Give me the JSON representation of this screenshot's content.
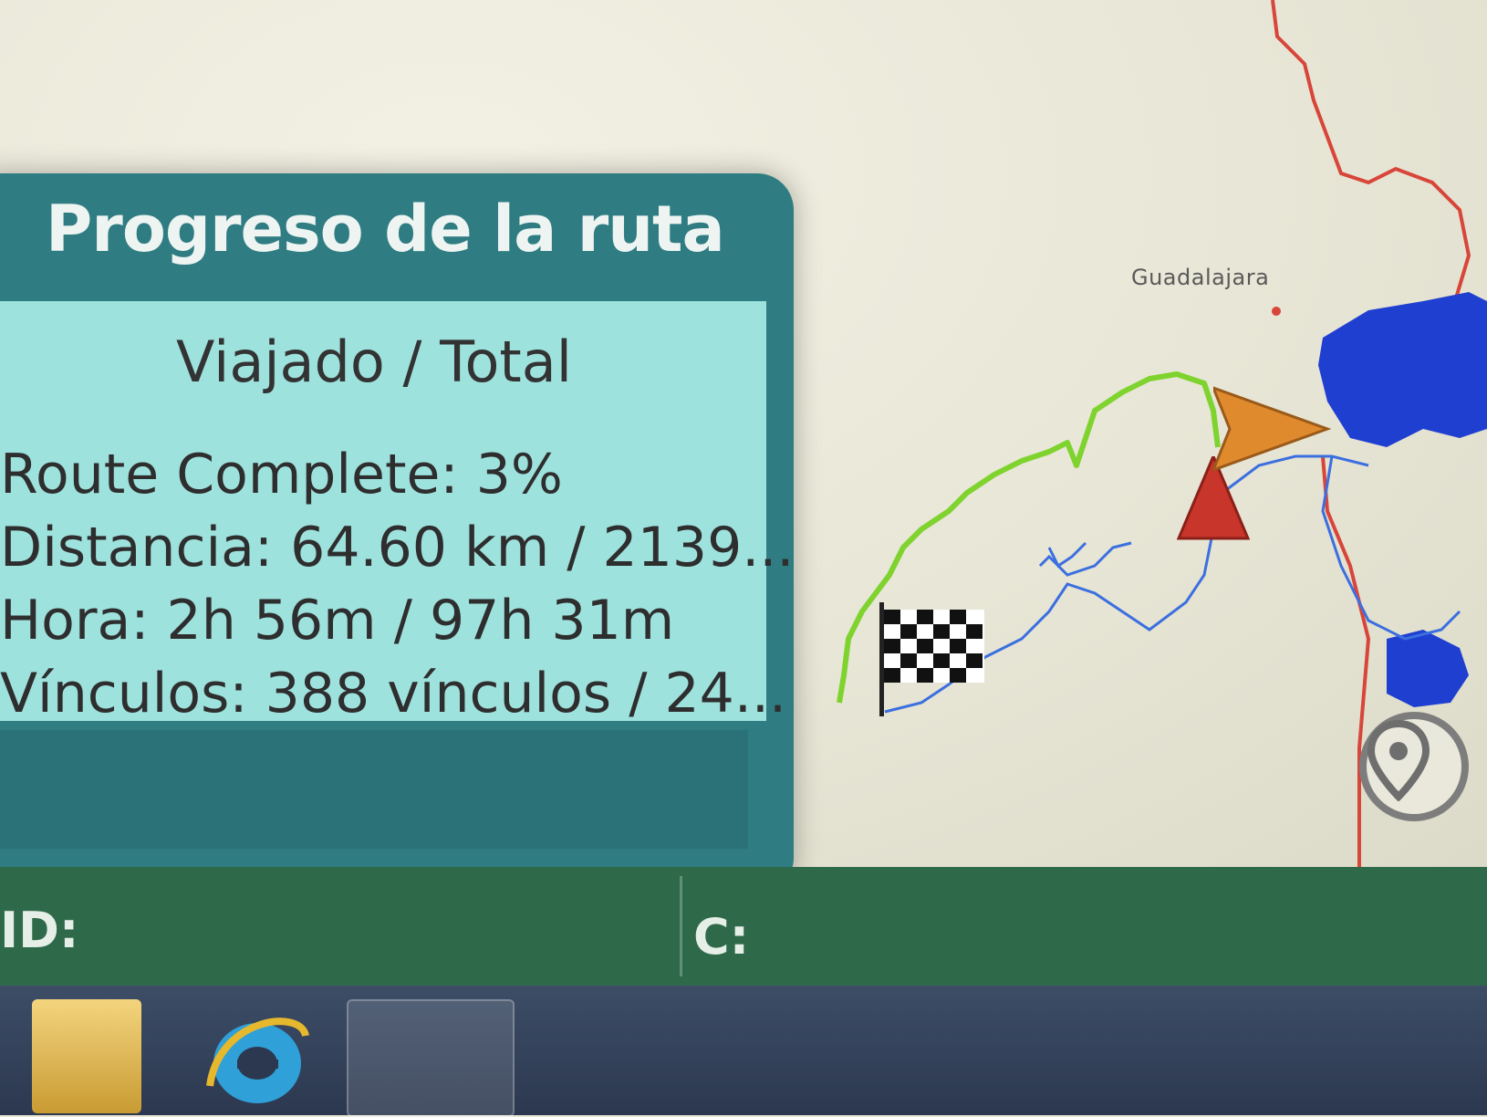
{
  "panel": {
    "title": "Progreso de la ruta",
    "subtitle": "Viajado / Total",
    "lines": [
      "Route Complete: 3%",
      "Distancia: 64.60 km / 2139...",
      "Hora: 2h 56m / 97h 31m",
      "Vínculos: 388 vínculos / 24..."
    ]
  },
  "map": {
    "city_label": "Guadalajara",
    "colors": {
      "traveled_route": "#7fd32e",
      "remaining_route": "#3b6fe0",
      "road": "#d8453a",
      "lake": "#1f3fd0",
      "vehicle_arrow": "#e08a2e",
      "start_marker": "#c8352a"
    },
    "icons": [
      "finish-flag-icon",
      "vehicle-arrow-icon",
      "start-marker-icon",
      "location-pin-icon"
    ]
  },
  "statusbar": {
    "id_label": "ID:",
    "c_label": "C:"
  },
  "taskbar": {
    "icons": [
      "folder-icon",
      "internet-explorer-icon",
      "app-icon"
    ]
  }
}
